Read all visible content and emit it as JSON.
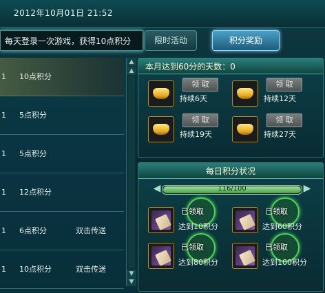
{
  "header": {
    "datetime": "2012年10月01日   21:52"
  },
  "tip": "每天登录一次游戏，获得10点积分",
  "tabs": [
    {
      "label": "限时活动",
      "active": false
    },
    {
      "label": "积分奖励",
      "active": true
    }
  ],
  "list": [
    {
      "num": "1",
      "points": "10点积分",
      "action": ""
    },
    {
      "num": "1",
      "points": "5点积分",
      "action": ""
    },
    {
      "num": "1",
      "points": "5点积分",
      "action": ""
    },
    {
      "num": "1",
      "points": "12点积分",
      "action": ""
    },
    {
      "num": "1",
      "points": "6点积分",
      "action": "双击传送"
    },
    {
      "num": "1",
      "points": "10点积分",
      "action": "双击传送"
    }
  ],
  "monthly": {
    "title": "本月达到60分的天数：0",
    "rewards": [
      {
        "claim_label": "领 取",
        "caption": "持续6天",
        "claimed": false
      },
      {
        "claim_label": "领 取",
        "caption": "持续12天",
        "claimed": false
      },
      {
        "claim_label": "领 取",
        "caption": "持续19天",
        "claimed": false
      },
      {
        "claim_label": "领 取",
        "caption": "持续27天",
        "claimed": false
      }
    ]
  },
  "daily": {
    "title": "每日积分状况",
    "progress_text": "116/100",
    "progress_value": 116,
    "progress_max": 100,
    "rewards": [
      {
        "badge": "已领取",
        "caption": "达到10积分",
        "claimed": true
      },
      {
        "badge": "已领取",
        "caption": "达到60积分",
        "claimed": true
      },
      {
        "badge": "已领取",
        "caption": "达到80积分",
        "claimed": true
      },
      {
        "badge": "已领取",
        "caption": "达到100积分",
        "claimed": true
      }
    ]
  },
  "colors": {
    "accent": "#8de4ff",
    "claimed_badge": "#53d05a",
    "progress_fill": "#4c9c4a"
  },
  "icons": {
    "monthly_reward": "gold-ingot-icon",
    "daily_reward": "scroll-icon",
    "scroll_up": "arrow-up-icon",
    "scroll_down": "arrow-down-icon"
  }
}
